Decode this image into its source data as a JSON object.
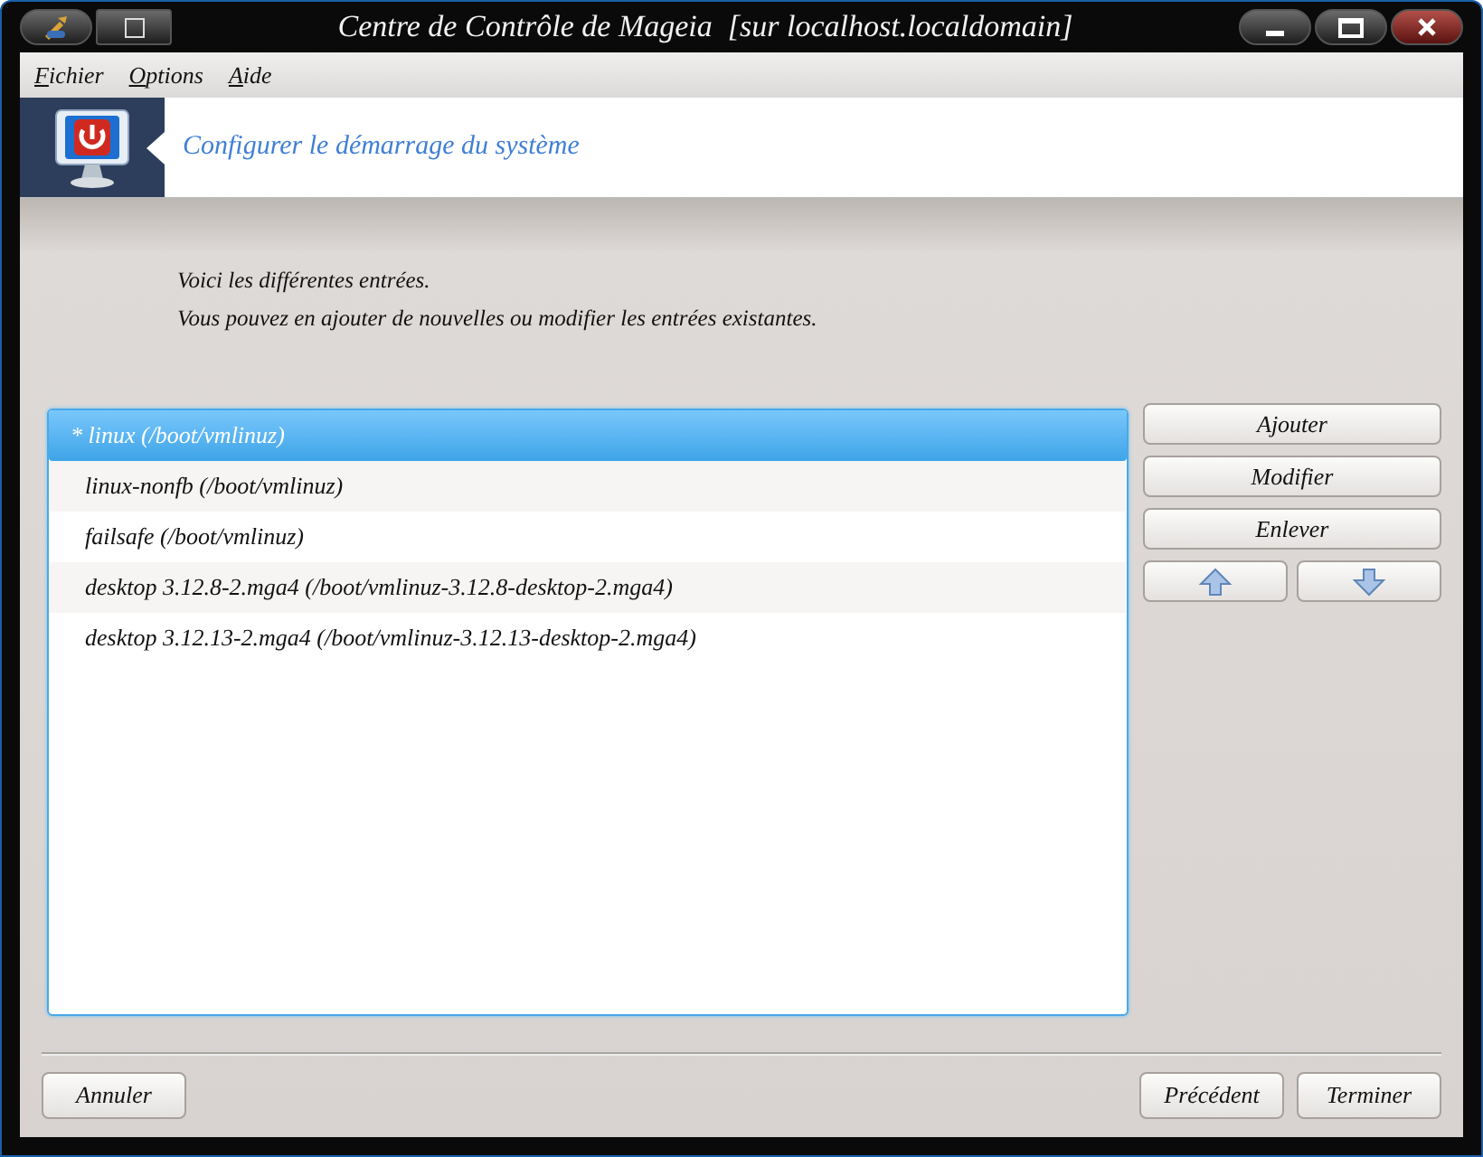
{
  "window": {
    "title": "Centre de Contrôle de Mageia  [sur localhost.localdomain]"
  },
  "menu": [
    "Fichier",
    "Options",
    "Aide"
  ],
  "header": {
    "title": "Configurer le démarrage du système"
  },
  "intro": [
    "Voici les différentes entrées.",
    "Vous pouvez en ajouter de nouvelles ou modifier les entrées existantes."
  ],
  "entries": [
    {
      "label": "* linux (/boot/vmlinuz)",
      "selected": true
    },
    {
      "label": "linux-nonfb (/boot/vmlinuz)",
      "selected": false
    },
    {
      "label": "failsafe (/boot/vmlinuz)",
      "selected": false
    },
    {
      "label": "desktop 3.12.8-2.mga4 (/boot/vmlinuz-3.12.8-desktop-2.mga4)",
      "selected": false
    },
    {
      "label": "desktop 3.12.13-2.mga4 (/boot/vmlinuz-3.12.13-desktop-2.mga4)",
      "selected": false
    }
  ],
  "side_buttons": [
    {
      "kind": "text",
      "label": "Ajouter"
    },
    {
      "kind": "text",
      "label": "Modifier"
    },
    {
      "kind": "text",
      "label": "Enlever"
    }
  ],
  "move_buttons": [
    {
      "kind": "up"
    },
    {
      "kind": "down"
    }
  ],
  "footer": {
    "left": [
      "Annuler"
    ],
    "right": [
      "Précédent",
      "Terminer"
    ]
  }
}
